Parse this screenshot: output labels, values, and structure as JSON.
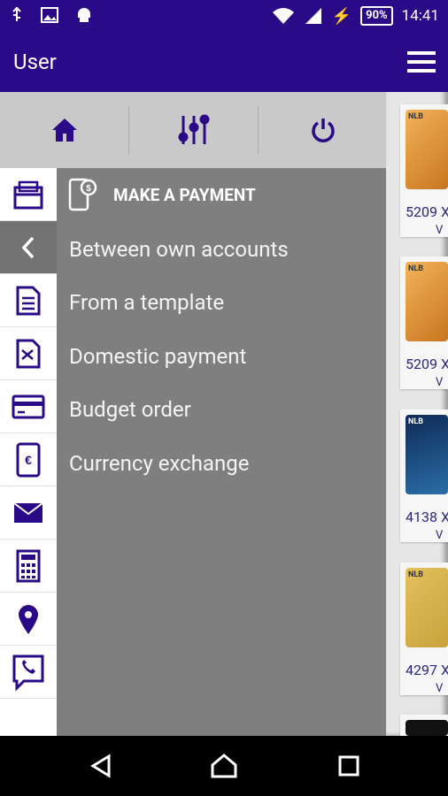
{
  "status_bar": {
    "battery": "90%",
    "time": "14:41"
  },
  "app_bar": {
    "title": "User"
  },
  "toolbar": {
    "buttons": [
      {
        "icon": "home-icon"
      },
      {
        "icon": "sliders-icon"
      },
      {
        "icon": "power-icon"
      }
    ]
  },
  "menu": {
    "header": "MAKE A PAYMENT",
    "items": [
      "Between own accounts",
      "From a template",
      "Domestic payment",
      "Budget order",
      "Currency exchange"
    ]
  },
  "side_rail": {
    "items": [
      "accounts-folder-icon",
      "back-chevron-icon",
      "document-icon",
      "transfer-icon",
      "card-icon",
      "mobile-exchange-icon",
      "mail-icon",
      "calculator-icon",
      "location-icon",
      "phone-icon"
    ]
  },
  "cards": [
    {
      "number": "5209 X",
      "sub": "V",
      "brand": "NLB"
    },
    {
      "number": "5209 X",
      "sub": "V",
      "brand": "NLB"
    },
    {
      "number": "4138 X",
      "sub": "V",
      "brand": "NLB"
    },
    {
      "number": "4297 X",
      "sub": "V",
      "brand": "NLB"
    }
  ],
  "colors": {
    "brand": "#2a0a86",
    "menu_bg": "#7f7f7f",
    "toolbar_bg": "#c9c9c9"
  }
}
